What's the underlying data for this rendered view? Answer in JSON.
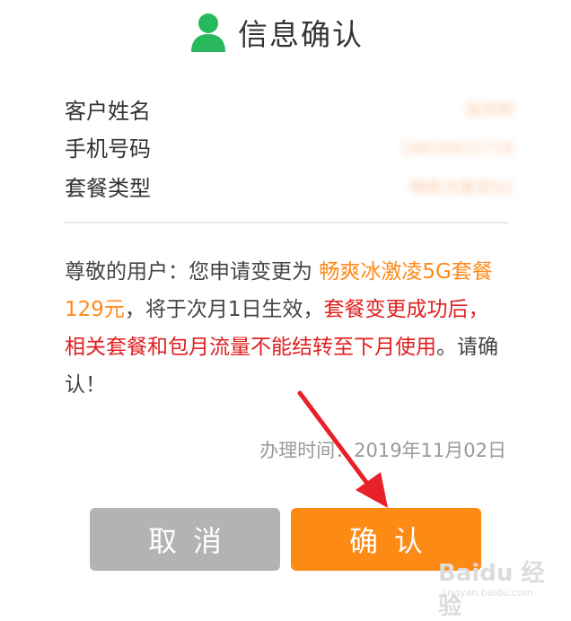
{
  "header": {
    "title": "信息确认",
    "icon": "user-icon"
  },
  "info": {
    "name_label": "客户姓名",
    "name_value": "张伟明",
    "phone_label": "手机号码",
    "phone_value": "18839915718",
    "plan_label": "套餐类型",
    "plan_value": "畅爽冰激凌5G"
  },
  "notice": {
    "part1": "尊敬的用户：您申请变更为 ",
    "plan": "畅爽冰激凌5G套餐129元",
    "part2": "，将于次月1日生效，",
    "warning": "套餐变更成功后，相关套餐和包月流量不能结转至下月使用",
    "part3": "。请确认！"
  },
  "handle_time": "办理时间：2019年11月02日",
  "buttons": {
    "cancel": "取消",
    "confirm": "确认"
  },
  "watermark": {
    "main": "Baidu 经验",
    "sub": "jingyan.baidu.com"
  },
  "colors": {
    "accent": "#fd8a14",
    "warning": "#e02020",
    "icon_green": "#27b95c",
    "cancel_gray": "#b3b3b3"
  }
}
